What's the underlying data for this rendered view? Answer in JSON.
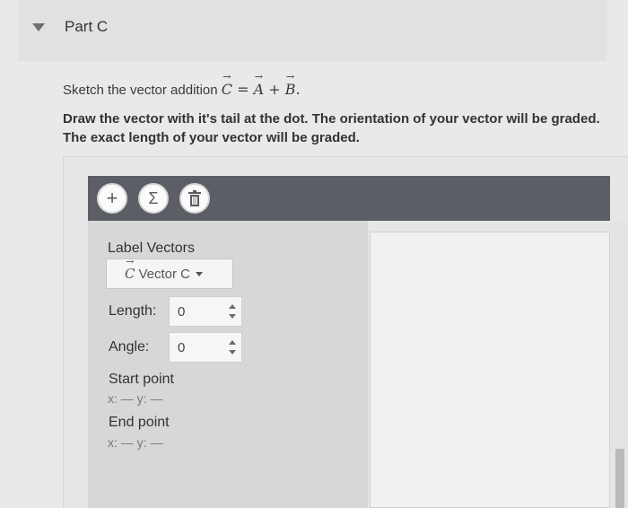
{
  "part": {
    "title": "Part C"
  },
  "instruction": {
    "prefix": "Sketch the vector addition ",
    "c": "C",
    "eq": " = ",
    "a": "A",
    "plus": " + ",
    "b": "B",
    "suffix": "."
  },
  "requirements": "Draw the vector with it's tail at the dot. The orientation of your vector will be graded. The exact length of your vector will be graded.",
  "toolbar": {
    "add_icon": "+",
    "sum_icon": "Σ",
    "trash_icon": "trash-icon"
  },
  "panel": {
    "label_vectors": "Label Vectors",
    "selected_symbol": "C",
    "selected_label": "Vector C",
    "length_label": "Length:",
    "length_value": "0",
    "angle_label": "Angle:",
    "angle_value": "0",
    "start_label": "Start point",
    "start_coords": "x: — y: —",
    "end_label": "End point",
    "end_coords": "x: — y: —"
  },
  "colors": {
    "toolbar": "#5b5e65",
    "panel": "#d7d7d7",
    "canvas": "#f1f1f1"
  }
}
